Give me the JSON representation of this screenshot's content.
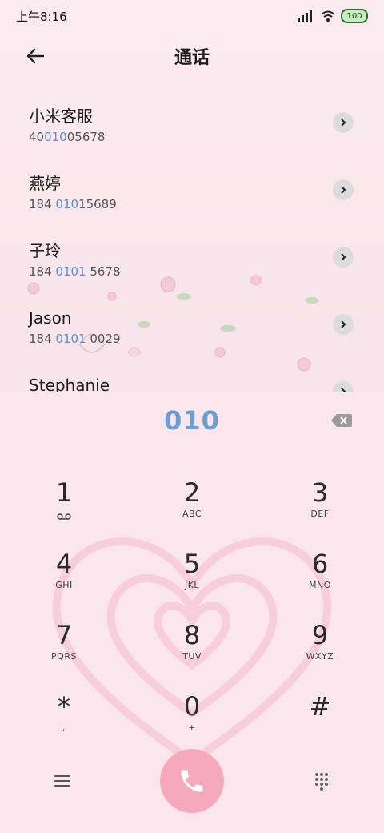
{
  "status_bar": {
    "time": "上午8:16",
    "battery": "100"
  },
  "header": {
    "title": "通话"
  },
  "contacts": [
    {
      "name": "小米客服",
      "num_pre": "40",
      "num_hl": "010",
      "num_post": "05678"
    },
    {
      "name": "燕婷",
      "num_pre": "184 ",
      "num_hl": "010",
      "num_post": "15689"
    },
    {
      "name": "子玲",
      "num_pre": "184 ",
      "num_hl": "0101",
      "num_post": " 5678"
    },
    {
      "name": "Jason",
      "num_pre": "184 ",
      "num_hl": "0101",
      "num_post": " 0029"
    },
    {
      "name": "Stephanie",
      "num_pre": "",
      "num_hl": "",
      "num_post": ""
    }
  ],
  "dialer": {
    "typed_number": "010",
    "keys": [
      {
        "digit": "1",
        "sub": ""
      },
      {
        "digit": "2",
        "sub": "ABC"
      },
      {
        "digit": "3",
        "sub": "DEF"
      },
      {
        "digit": "4",
        "sub": "GHI"
      },
      {
        "digit": "5",
        "sub": "JKL"
      },
      {
        "digit": "6",
        "sub": "MNO"
      },
      {
        "digit": "7",
        "sub": "PQRS"
      },
      {
        "digit": "8",
        "sub": "TUV"
      },
      {
        "digit": "9",
        "sub": "WXYZ"
      },
      {
        "digit": "*",
        "sub": ","
      },
      {
        "digit": "0",
        "sub": "+"
      },
      {
        "digit": "#",
        "sub": ""
      }
    ]
  },
  "colors": {
    "highlight": "#5a8ed6",
    "call_button": "#f6a9bd",
    "background": "#fce6ed"
  }
}
